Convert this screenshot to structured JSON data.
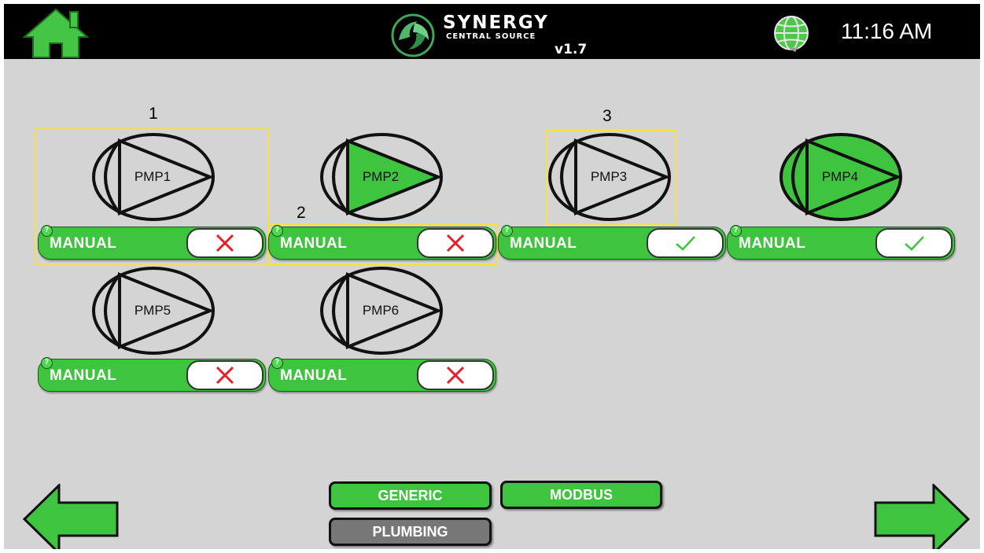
{
  "header": {
    "logo_title": "SYNERGY",
    "logo_subtitle": "CENTRAL SOURCE",
    "version": "v1.7",
    "time": "11:16 AM",
    "home_icon": "home-icon",
    "network_icon": "globe-icon"
  },
  "colors": {
    "accent_green": "#3ec43e",
    "selection_yellow": "#f2e14a",
    "inactive_gray": "#777777",
    "cross_red": "#e61e2a",
    "check_green": "#3ec43e"
  },
  "annotations": [
    "1",
    "2",
    "3"
  ],
  "pumps": [
    {
      "label": "PMP1",
      "running": "off",
      "mode": "MANUAL",
      "help": "?",
      "status": "off"
    },
    {
      "label": "PMP2",
      "running": "partial",
      "mode": "MANUAL",
      "help": "?",
      "status": "off"
    },
    {
      "label": "PMP3",
      "running": "off",
      "mode": "MANUAL",
      "help": "?",
      "status": "on"
    },
    {
      "label": "PMP4",
      "running": "full",
      "mode": "MANUAL",
      "help": "?",
      "status": "on"
    },
    {
      "label": "PMP5",
      "running": "off",
      "mode": "MANUAL",
      "help": "?",
      "status": "off"
    },
    {
      "label": "PMP6",
      "running": "off",
      "mode": "MANUAL",
      "help": "?",
      "status": "off"
    }
  ],
  "categories": {
    "generic": "GENERIC",
    "modbus": "MODBUS",
    "plumbing": "PLUMBING"
  },
  "nav": {
    "prev_icon": "arrow-left-icon",
    "next_icon": "arrow-right-icon"
  }
}
